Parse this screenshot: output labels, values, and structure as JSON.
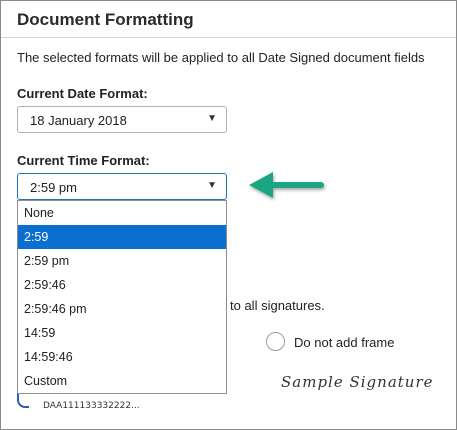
{
  "panel": {
    "title": "Document Formatting",
    "description": "The selected formats will be applied to all Date Signed document fields"
  },
  "date_format": {
    "label": "Current Date Format:",
    "value": "18 January 2018"
  },
  "time_format": {
    "label": "Current Time Format:",
    "value": "2:59 pm",
    "options": [
      "None",
      "2:59",
      "2:59 pm",
      "2:59:46",
      "2:59:46 pm",
      "14:59",
      "14:59:46",
      "Custom"
    ],
    "highlighted_option": "2:59"
  },
  "signatures": {
    "partial_text": "to all signatures.",
    "no_frame_label": "Do not add frame",
    "sample_signature": "Sample Signature",
    "stamp_code": "DAA111133332222..."
  },
  "colors": {
    "accent_blue": "#0a6fd1",
    "focus_border": "#1e74c9",
    "arrow_green": "#1fa585"
  },
  "icons": {
    "caret": "caret-down-icon",
    "callout": "arrow-left-icon"
  }
}
